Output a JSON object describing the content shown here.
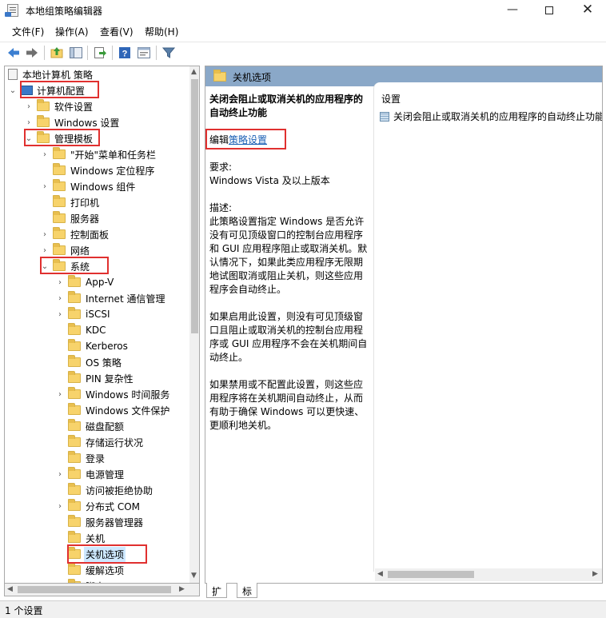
{
  "window": {
    "title": "本地组策略编辑器",
    "minimize": "—",
    "close": "✕"
  },
  "menu": [
    "文件(F)",
    "操作(A)",
    "查看(V)",
    "帮助(H)"
  ],
  "toolbar": [
    "back-icon",
    "forward-icon",
    "up-folder-icon",
    "show-hide-tree-icon",
    "export-icon",
    "help-icon",
    "properties-icon",
    "filter-icon"
  ],
  "tree": {
    "root": "本地计算机 策略",
    "computer": "计算机配置",
    "software": "软件设置",
    "windows_settings": "Windows 设置",
    "admin_templates": "管理模板",
    "start_menu": "\"开始\"菜单和任务栏",
    "location": "Windows 定位程序",
    "components": "Windows 组件",
    "printers": "打印机",
    "server": "服务器",
    "control_panel": "控制面板",
    "network": "网络",
    "system": "系统",
    "system_children": [
      "App-V",
      "Internet 通信管理",
      "iSCSI",
      "KDC",
      "Kerberos",
      "OS 策略",
      "PIN 复杂性",
      "Windows 时间服务",
      "Windows 文件保护",
      "磁盘配额",
      "存储运行状况",
      "登录",
      "电源管理",
      "访问被拒绝协助",
      "分布式 COM",
      "服务器管理器",
      "关机",
      "关机选项",
      "缓解选项",
      "脚本"
    ]
  },
  "right": {
    "header": "关机选项",
    "desc_title": "关闭会阻止或取消关机的应用程序的自动终止功能",
    "edit_prefix": "编辑",
    "edit_link": "策略设置",
    "req_label": "要求:",
    "req_value": "Windows Vista 及以上版本",
    "desc_label": "描述:",
    "para1": "此策略设置指定 Windows 是否允许没有可见顶级窗口的控制台应用程序和 GUI 应用程序阻止或取消关机。默认情况下，如果此类应用程序无限期地试图取消或阻止关机，则这些应用程序会自动终止。",
    "para2": "如果启用此设置，则没有可见顶级窗口且阻止或取消关机的控制台应用程序或 GUI 应用程序不会在关机期间自动终止。",
    "para3": "如果禁用或不配置此设置，则这些应用程序将在关机期间自动终止，从而有助于确保 Windows 可以更快速、更顺利地关机。",
    "column": "设置",
    "setting": "关闭会阻止或取消关机的应用程序的自动终止功能"
  },
  "tabs": [
    "扩展",
    "标准"
  ],
  "status": "1 个设置",
  "colors": {
    "highlight": "#e0302f",
    "header_bar": "#8aa8c8",
    "selection": "#cde8ff",
    "link": "#1a5fb4"
  }
}
